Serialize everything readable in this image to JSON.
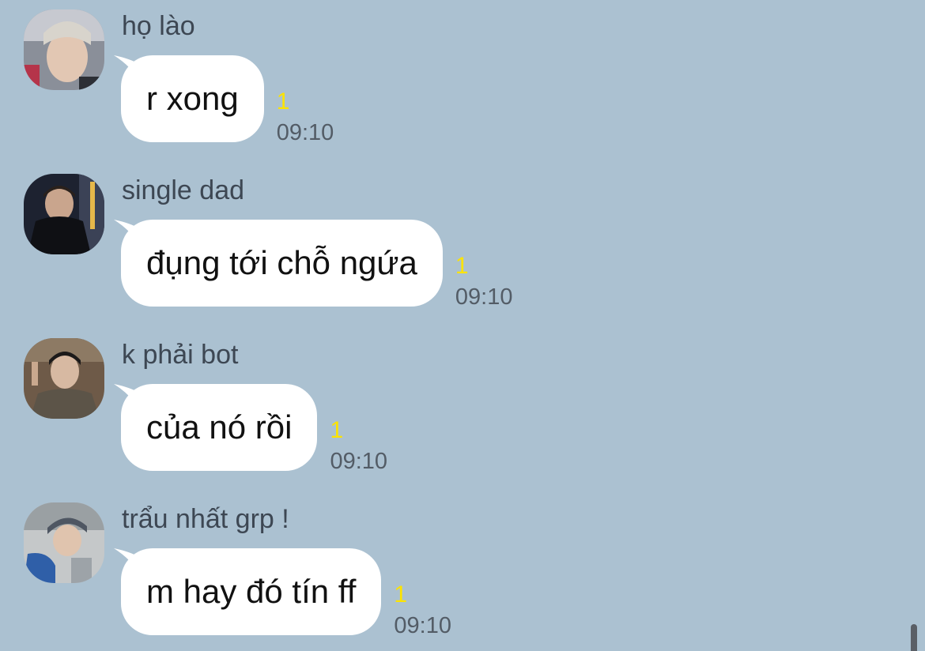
{
  "messages": [
    {
      "sender": "họ lào",
      "text": "r xong",
      "unread": "1",
      "time": "09:10",
      "avatar_icon": "avatar-photo-1"
    },
    {
      "sender": "single dad",
      "text": "đụng tới chỗ ngứa",
      "unread": "1",
      "time": "09:10",
      "avatar_icon": "avatar-photo-2"
    },
    {
      "sender": "k phải bot",
      "text": "của nó rồi",
      "unread": "1",
      "time": "09:10",
      "avatar_icon": "avatar-photo-3"
    },
    {
      "sender": "trẩu nhất grp !",
      "text": "m hay đó tín ff",
      "unread": "1",
      "time": "09:10",
      "avatar_icon": "avatar-photo-4"
    }
  ],
  "colors": {
    "background": "#abc1d1",
    "bubble": "#ffffff",
    "unread": "#fce300",
    "time": "#535c66",
    "sender": "#3d4753"
  }
}
